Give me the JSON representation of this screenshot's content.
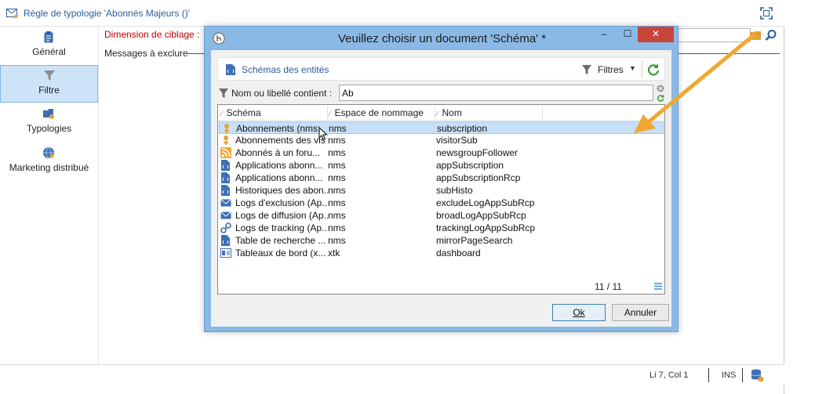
{
  "window": {
    "title": "Règle de typologie 'Abonnés Majeurs ()'"
  },
  "sidebar": {
    "items": [
      {
        "label": "Général",
        "icon": "clipboard-icon"
      },
      {
        "label": "Filtre",
        "icon": "funnel-icon"
      },
      {
        "label": "Typologies",
        "icon": "typology-icon"
      },
      {
        "label": "Marketing distribué",
        "icon": "globe-icon"
      }
    ],
    "active_index": 1
  },
  "form": {
    "target_dimension_label": "Dimension de ciblage :",
    "exclude_messages_label": "Messages à exclure"
  },
  "status_bar": {
    "position": "Li 7, Col 1",
    "mode": "INS"
  },
  "dialog": {
    "title": "Veuillez choisir un document 'Schéma' *",
    "window_buttons": {
      "minimize": "–",
      "maximize": "☐",
      "close": "✕"
    },
    "toolbar": {
      "label": "Schémas des entités",
      "filters_label": "Filtres"
    },
    "search": {
      "label": "Nom ou libellé contient :",
      "value": "Ab"
    },
    "columns": [
      "Schéma",
      "Espace de nommage",
      "Nom"
    ],
    "rows": [
      {
        "schema": "Abonnements (nms:",
        "namespace": "nms",
        "name": "subscription",
        "icon": "subscription-icon",
        "selected": true
      },
      {
        "schema": "Abonnements des vis",
        "namespace": "nms",
        "name": "visitorSub",
        "icon": "subscription-icon",
        "selected": false
      },
      {
        "schema": "Abonnés à un foru...",
        "namespace": "nms",
        "name": "newsgroupFollower",
        "icon": "rss-icon",
        "selected": false
      },
      {
        "schema": "Applications abonn...",
        "namespace": "nms",
        "name": "appSubscription",
        "icon": "document-icon",
        "selected": false
      },
      {
        "schema": "Applications abonn...",
        "namespace": "nms",
        "name": "appSubscriptionRcp",
        "icon": "document-icon",
        "selected": false
      },
      {
        "schema": "Historiques des abon...",
        "namespace": "nms",
        "name": "subHisto",
        "icon": "document-icon",
        "selected": false
      },
      {
        "schema": "Logs d'exclusion (Ap...",
        "namespace": "nms",
        "name": "excludeLogAppSubRcp",
        "icon": "envelope-icon",
        "selected": false
      },
      {
        "schema": "Logs de diffusion (Ap...",
        "namespace": "nms",
        "name": "broadLogAppSubRcp",
        "icon": "envelope-icon",
        "selected": false
      },
      {
        "schema": "Logs de tracking (Ap...",
        "namespace": "nms",
        "name": "trackingLogAppSubRcp",
        "icon": "tracking-icon",
        "selected": false
      },
      {
        "schema": "Table de recherche ...",
        "namespace": "nms",
        "name": "mirrorPageSearch",
        "icon": "document-icon",
        "selected": false
      },
      {
        "schema": "Tableaux de bord (x...",
        "namespace": "xtk",
        "name": "dashboard",
        "icon": "dashboard-icon",
        "selected": false
      }
    ],
    "count": "11 / 11",
    "buttons": {
      "ok": "Ok",
      "cancel": "Annuler"
    }
  },
  "colors": {
    "accent_blue": "#2a5d9c",
    "dialog_frame": "#8ab9e6",
    "close_red": "#c7443a",
    "selection": "#c7dff7",
    "arrow_orange": "#f0a830",
    "required_red": "#c00000"
  }
}
